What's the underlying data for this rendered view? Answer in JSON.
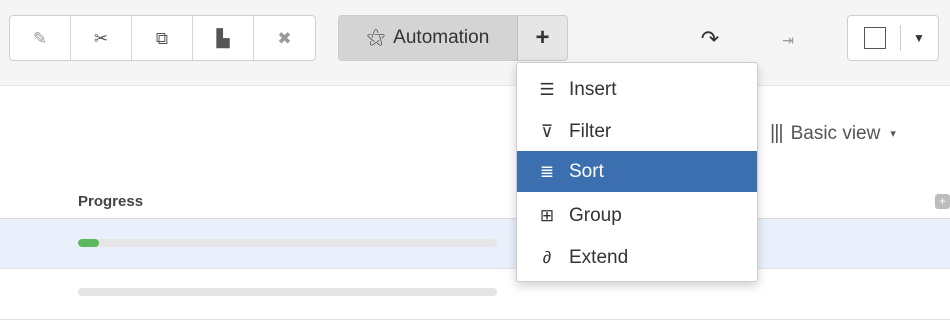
{
  "toolbar": {
    "edit_group": [
      {
        "name": "edit-button",
        "icon": "pencil-icon",
        "glyph": "✎"
      },
      {
        "name": "cut-button",
        "icon": "scissors-icon",
        "glyph": "✂"
      },
      {
        "name": "copy-button",
        "icon": "copy-icon",
        "glyph": "⧉"
      },
      {
        "name": "paste-button",
        "icon": "paste-icon",
        "glyph": "▙"
      },
      {
        "name": "delete-button",
        "icon": "close-icon",
        "glyph": "✖"
      }
    ],
    "automation": {
      "label": "Automation",
      "icon": "magic-wand-icon",
      "glyph": "⚝"
    },
    "add_button": {
      "glyph": "+"
    },
    "redo_glyph": "↷",
    "logout_glyph": "⇥",
    "caret_glyph": "▼"
  },
  "view_selector": {
    "bars_glyph": "|||",
    "label": "Basic view",
    "caret_glyph": "▾"
  },
  "table": {
    "column_header": "Progress",
    "add_column_glyph": "+",
    "rows": [
      {
        "progress": 0.05,
        "selected": true
      },
      {
        "progress": 0.0,
        "selected": false
      }
    ]
  },
  "menu": {
    "items": [
      {
        "label": "Insert",
        "icon": "insert-rows-icon",
        "glyph": "☰",
        "active": false
      },
      {
        "label": "Filter",
        "icon": "filter-icon",
        "glyph": "⊽",
        "active": false
      },
      {
        "label": "Sort",
        "icon": "sort-icon",
        "glyph": "≣",
        "active": true
      },
      {
        "label": "Group",
        "icon": "group-icon",
        "glyph": "⊞",
        "active": false
      },
      {
        "label": "Extend",
        "icon": "link-icon",
        "glyph": "∂",
        "active": false
      }
    ]
  },
  "colors": {
    "accent": "#3c6fb0",
    "progress": "#5cb85c",
    "selection": "#e9f0fb"
  }
}
